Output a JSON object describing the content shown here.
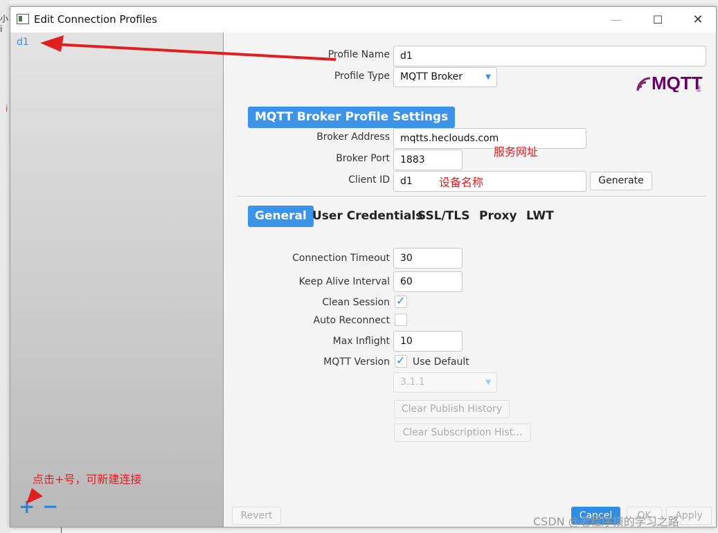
{
  "window": {
    "title": "Edit Connection Profiles"
  },
  "sidebar": {
    "profiles": [
      "d1"
    ],
    "add_label": "+",
    "remove_label": "−"
  },
  "profile": {
    "name_label": "Profile Name",
    "name_value": "d1",
    "type_label": "Profile Type",
    "type_value": "MQTT Broker"
  },
  "logo": {
    "text": "MQTT",
    "suffix": "org"
  },
  "section": {
    "title": "MQTT Broker Profile Settings",
    "broker_address_label": "Broker Address",
    "broker_address_value": "mqtts.heclouds.com",
    "broker_port_label": "Broker Port",
    "broker_port_value": "1883",
    "client_id_label": "Client ID",
    "client_id_value": "d1",
    "generate_label": "Generate"
  },
  "tabs": [
    "General",
    "User Credentials",
    "SSL/TLS",
    "Proxy",
    "LWT"
  ],
  "general": {
    "connection_timeout_label": "Connection Timeout",
    "connection_timeout_value": "30",
    "keep_alive_label": "Keep Alive Interval",
    "keep_alive_value": "60",
    "clean_session_label": "Clean Session",
    "clean_session_checked": true,
    "auto_reconnect_label": "Auto Reconnect",
    "auto_reconnect_checked": false,
    "max_inflight_label": "Max Inflight",
    "max_inflight_value": "10",
    "mqtt_version_label": "MQTT Version",
    "use_default_label": "Use Default",
    "use_default_checked": true,
    "version_value": "3.1.1",
    "clear_publish_label": "Clear Publish History",
    "clear_subscription_label": "Clear Subscription Hist..."
  },
  "footer": {
    "revert_label": "Revert",
    "cancel_label": "Cancel",
    "ok_label": "OK",
    "apply_label": "Apply"
  },
  "annotations": {
    "broker_address_note": "服务网址",
    "client_id_note": "设备名称",
    "add_note": "点击+号，可新建连接",
    "color": "#e02020"
  },
  "watermark": "CSDN @老程序猿的学习之路",
  "background": {
    "left_text_1": "小i",
    "left_text_2": "i"
  },
  "colors": {
    "accent": "#3d93e6",
    "link": "#3b8fe0",
    "annotation": "#e02020"
  }
}
